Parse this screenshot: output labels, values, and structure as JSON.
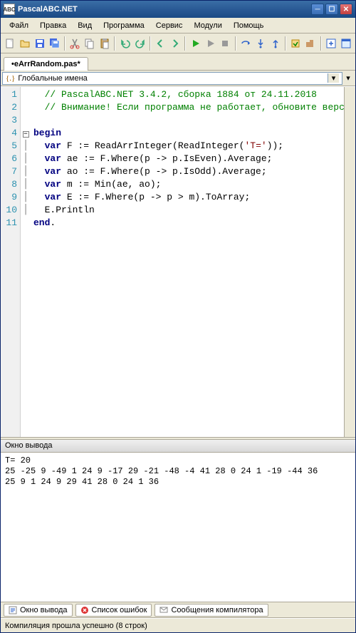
{
  "titlebar": {
    "title": "PascalABC.NET",
    "icon_text": "ABC"
  },
  "menu": {
    "file": "Файл",
    "edit": "Правка",
    "view": "Вид",
    "program": "Программа",
    "service": "Сервис",
    "modules": "Модули",
    "help": "Помощь"
  },
  "tab": {
    "filename": "•eArrRandom.pas*"
  },
  "combo": {
    "icon": "{.}",
    "text": "Глобальные имена"
  },
  "code": {
    "lines": [
      {
        "n": "1",
        "fold": "",
        "html": "  <span class='cmt'>// PascalABC.NET 3.4.2, сборка 1884 от 24.11.2018</span>"
      },
      {
        "n": "2",
        "fold": "",
        "html": "  <span class='cmt'>// Внимание! Если программа не работает, обновите версию!</span>"
      },
      {
        "n": "3",
        "fold": "",
        "html": ""
      },
      {
        "n": "4",
        "fold": "-",
        "html": "<span class='kw'>begin</span>"
      },
      {
        "n": "5",
        "fold": "|",
        "html": "  <span class='kw'>var</span> F := ReadArrInteger(ReadInteger(<span class='str'>'T='</span>));"
      },
      {
        "n": "6",
        "fold": "|",
        "html": "  <span class='kw'>var</span> ae := F.Where(p -> p.IsEven).Average;"
      },
      {
        "n": "7",
        "fold": "|",
        "html": "  <span class='kw'>var</span> ao := F.Where(p -> p.IsOdd).Average;"
      },
      {
        "n": "8",
        "fold": "|",
        "html": "  <span class='kw'>var</span> m := Min(ae, ao);"
      },
      {
        "n": "9",
        "fold": "|",
        "html": "  <span class='kw'>var</span> E := F.Where(p -> p > m).ToArray;"
      },
      {
        "n": "10",
        "fold": "|",
        "html": "  E.Println"
      },
      {
        "n": "11",
        "fold": "",
        "html": "<span class='kw'>end</span>."
      }
    ]
  },
  "output": {
    "title": "Окно вывода",
    "text": "T= 20\n25 -25 9 -49 1 24 9 -17 29 -21 -48 -4 41 28 0 24 1 -19 -44 36\n25 9 1 24 9 29 41 28 0 24 1 36"
  },
  "bottomtabs": {
    "output": "Окно вывода",
    "errors": "Список ошибок",
    "compiler": "Сообщения компилятора"
  },
  "status": {
    "text": "Компиляция прошла успешно (8 строк)"
  }
}
